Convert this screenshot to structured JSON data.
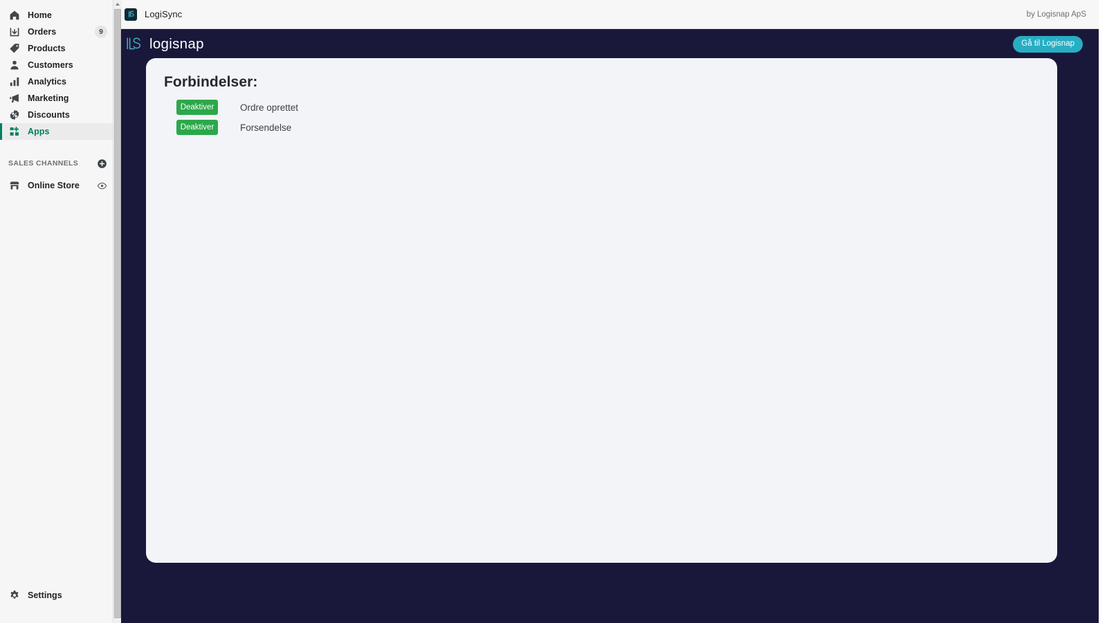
{
  "sidebar": {
    "items": [
      {
        "label": "Home",
        "icon": "home-icon",
        "badge": null,
        "active": false
      },
      {
        "label": "Orders",
        "icon": "orders-icon",
        "badge": "9",
        "active": false
      },
      {
        "label": "Products",
        "icon": "products-icon",
        "badge": null,
        "active": false
      },
      {
        "label": "Customers",
        "icon": "customers-icon",
        "badge": null,
        "active": false
      },
      {
        "label": "Analytics",
        "icon": "analytics-icon",
        "badge": null,
        "active": false
      },
      {
        "label": "Marketing",
        "icon": "marketing-icon",
        "badge": null,
        "active": false
      },
      {
        "label": "Discounts",
        "icon": "discounts-icon",
        "badge": null,
        "active": false
      },
      {
        "label": "Apps",
        "icon": "apps-icon",
        "badge": null,
        "active": true
      }
    ],
    "section": {
      "title": "SALES CHANNELS",
      "add_icon": "plus-circle-icon"
    },
    "channels": [
      {
        "label": "Online Store",
        "icon": "store-icon",
        "action_icon": "eye-icon"
      }
    ],
    "footer": {
      "label": "Settings",
      "icon": "gear-icon"
    },
    "active_accent": "#008060"
  },
  "host_bar": {
    "favicon": "logisync-favicon",
    "title": "LogiSync",
    "by_text": "by Logisnap ApS"
  },
  "brand": {
    "mark": "logisnap-ls-mark",
    "wordmark": "logisnap",
    "cta_label": "Gå til Logisnap",
    "cta_color": "#27aec3",
    "background": "#19183a"
  },
  "card": {
    "title": "Forbindelser:",
    "connections": [
      {
        "button_label": "Deaktiver",
        "name": "Ordre oprettet"
      },
      {
        "button_label": "Deaktiver",
        "name": "Forsendelse"
      }
    ],
    "button_color": "#2ba84a",
    "background": "#f2f4f8"
  },
  "scrollbar": {
    "up_arrow_icon": "scroll-up-arrow-icon"
  }
}
